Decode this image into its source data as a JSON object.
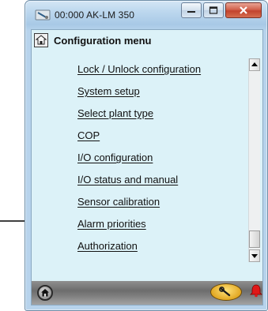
{
  "window": {
    "title": "00:000 AK-LM 350",
    "buttons": [
      "minimize",
      "maximize",
      "close"
    ]
  },
  "menu": {
    "title": "Configuration menu",
    "items": [
      {
        "label": "Lock / Unlock configuration"
      },
      {
        "label": "System setup"
      },
      {
        "label": "Select plant type"
      },
      {
        "label": "COP"
      },
      {
        "label": "I/O configuration"
      },
      {
        "label": "I/O status and manual"
      },
      {
        "label": "Sensor calibration"
      },
      {
        "label": "Alarm priorities"
      },
      {
        "label": "Authorization"
      }
    ],
    "highlighted_item": "Alarm priorities"
  },
  "bottom_bar": {
    "icons": [
      "home-icon",
      "wrench-icon",
      "alarm-bell-icon"
    ]
  },
  "colors": {
    "client_background": "#dcf2f8",
    "bottom_bar": "#7c7c7c",
    "service_button": "#e2a823",
    "alarm": "#e01818",
    "close_button": "#c2432d"
  }
}
